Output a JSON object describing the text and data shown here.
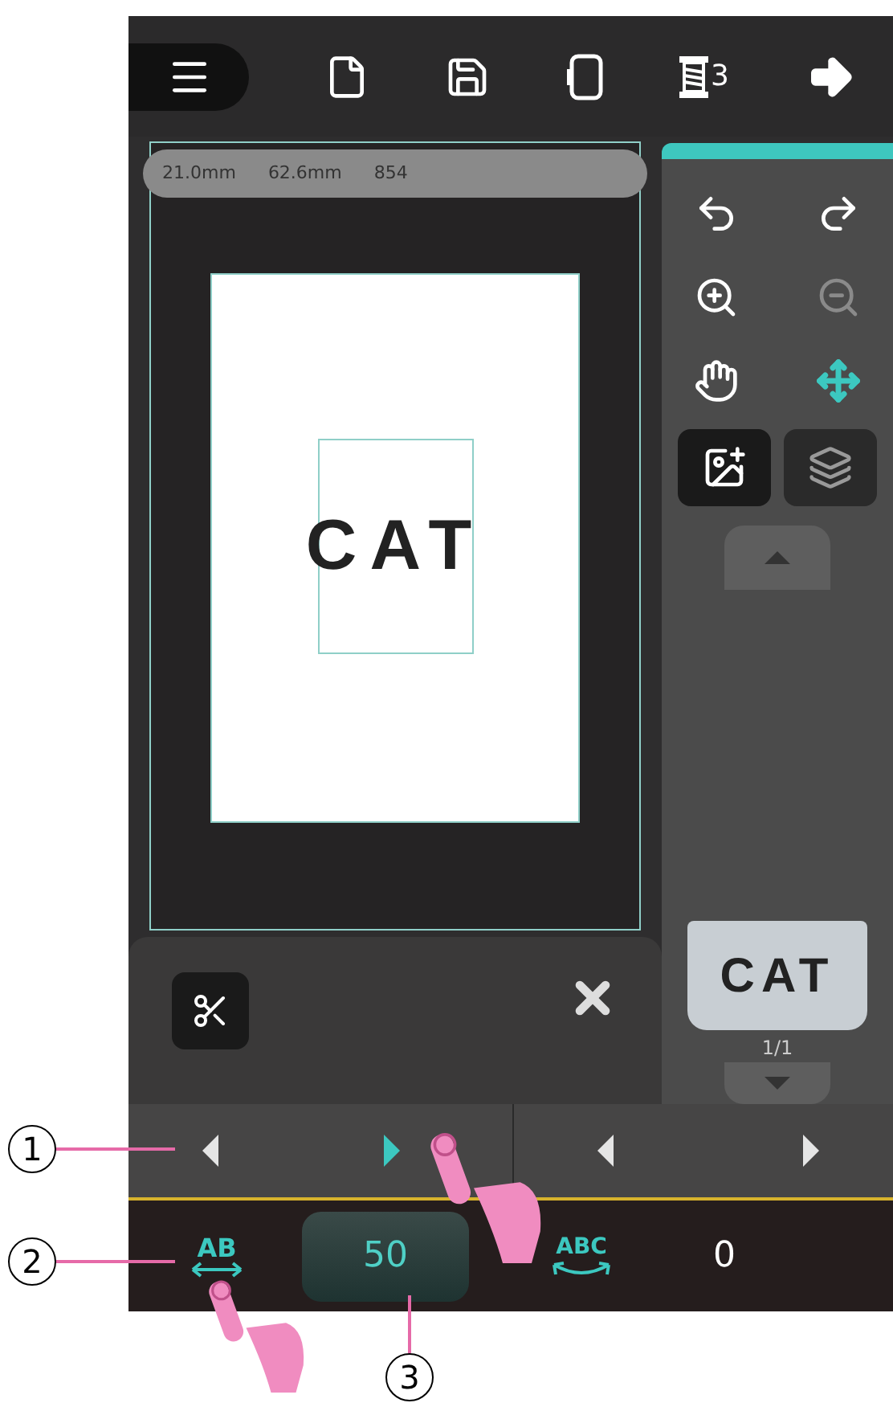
{
  "toolbar": {
    "spool_count": "3"
  },
  "info_bar": [
    "21.0mm",
    "62.6mm",
    "854"
  ],
  "canvas": {
    "text": "CAT"
  },
  "tools": [
    {
      "kind": "undo",
      "disabled": false,
      "selected": false
    },
    {
      "kind": "redo",
      "disabled": false,
      "selected": false
    },
    {
      "kind": "zoom-in",
      "disabled": false,
      "selected": false
    },
    {
      "kind": "zoom-out",
      "disabled": true,
      "selected": false
    },
    {
      "kind": "pan",
      "disabled": false,
      "selected": false
    },
    {
      "kind": "move",
      "disabled": false,
      "selected": true
    }
  ],
  "preview": {
    "text": "CAT",
    "page": "1/1"
  },
  "arrows": [
    {
      "kind": "left",
      "pressed": false
    },
    {
      "kind": "right",
      "pressed": true
    },
    {
      "kind": "left",
      "pressed": false
    },
    {
      "kind": "right",
      "pressed": false
    }
  ],
  "spacing": {
    "icon_text": "AB",
    "value": "50"
  },
  "arc": {
    "icon_text": "ABC",
    "value": "0"
  },
  "callouts": [
    "1",
    "2",
    "3"
  ]
}
